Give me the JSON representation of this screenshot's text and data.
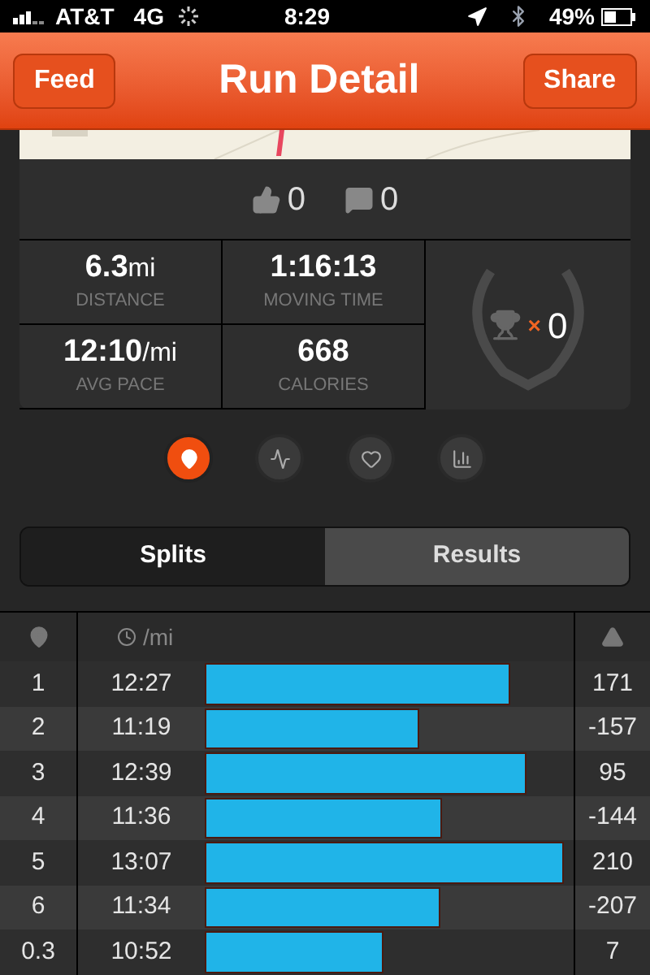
{
  "status_bar": {
    "carrier": "AT&T",
    "network": "4G",
    "time": "8:29",
    "battery": "49%"
  },
  "nav": {
    "back": "Feed",
    "title": "Run Detail",
    "action": "Share"
  },
  "social": {
    "kudos": "0",
    "comments": "0"
  },
  "stats": [
    {
      "value": "6.3",
      "unit": "mi",
      "label": "DISTANCE"
    },
    {
      "value": "1:16:13",
      "label": "MOVING TIME"
    },
    {
      "value": "12:10",
      "unit": "/mi",
      "label": "AVG PACE"
    },
    {
      "value": "668",
      "label": "CALORIES"
    }
  ],
  "achievements": {
    "multiplier": "×",
    "count": "0"
  },
  "views": [
    {
      "kind": "map",
      "selected": true
    },
    {
      "kind": "pace",
      "selected": false
    },
    {
      "kind": "heart",
      "selected": false
    },
    {
      "kind": "chart",
      "selected": false
    }
  ],
  "tabs": [
    {
      "label": "Splits",
      "selected": true
    },
    {
      "label": "Results",
      "selected": false
    }
  ],
  "splits": {
    "pace_unit": "/mi",
    "rows": [
      {
        "mile": "1",
        "pace": "12:27",
        "elevation": "171"
      },
      {
        "mile": "2",
        "pace": "11:19",
        "elevation": "-157"
      },
      {
        "mile": "3",
        "pace": "12:39",
        "elevation": "95"
      },
      {
        "mile": "4",
        "pace": "11:36",
        "elevation": "-144"
      },
      {
        "mile": "5",
        "pace": "13:07",
        "elevation": "210"
      },
      {
        "mile": "6",
        "pace": "11:34",
        "elevation": "-207"
      },
      {
        "mile": "0.3",
        "pace": "10:52",
        "elevation": "7"
      }
    ]
  }
}
